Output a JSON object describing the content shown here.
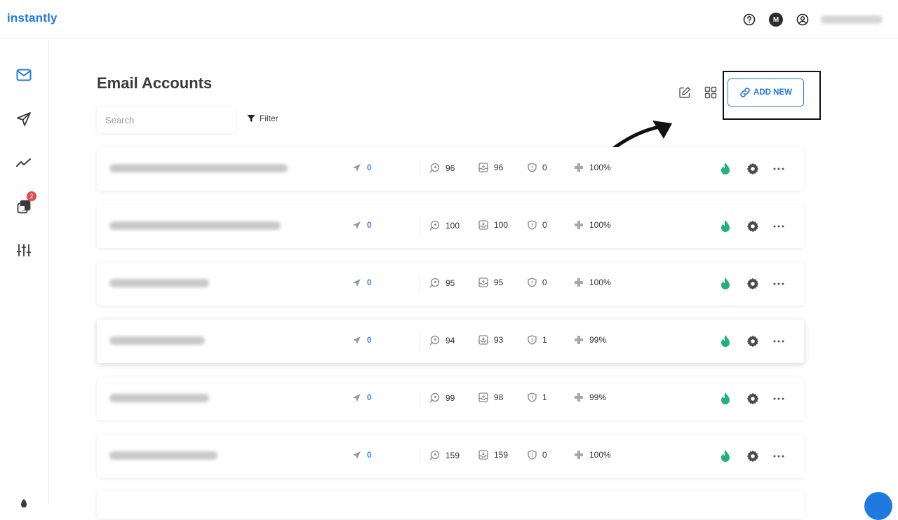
{
  "app": {
    "logo": "instantly"
  },
  "header": {
    "avatar_initial": "M"
  },
  "sidebar": {
    "campaigns_badge": "2"
  },
  "main": {
    "title": "Email Accounts",
    "search": {
      "placeholder": "Search"
    },
    "filter_label": "Filter",
    "add_new_label": "ADD NEW"
  },
  "accounts": [
    {
      "sent": "0",
      "warmup": "96",
      "inbox": "96",
      "spam": "0",
      "health": "100%"
    },
    {
      "sent": "0",
      "warmup": "100",
      "inbox": "100",
      "spam": "0",
      "health": "100%"
    },
    {
      "sent": "0",
      "warmup": "95",
      "inbox": "95",
      "spam": "0",
      "health": "100%"
    },
    {
      "sent": "0",
      "warmup": "94",
      "inbox": "93",
      "spam": "1",
      "health": "99%"
    },
    {
      "sent": "0",
      "warmup": "99",
      "inbox": "98",
      "spam": "1",
      "health": "99%"
    },
    {
      "sent": "0",
      "warmup": "159",
      "inbox": "159",
      "spam": "0",
      "health": "100%"
    }
  ],
  "colors": {
    "brand": "#1f7ae0",
    "warmup_active": "#22b07d",
    "badge": "#e5484d"
  }
}
